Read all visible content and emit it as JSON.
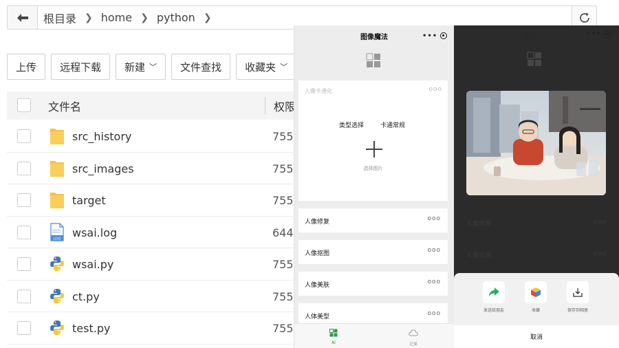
{
  "path_bar": {
    "crumbs": [
      "根目录",
      "home",
      "python"
    ]
  },
  "toolbar": {
    "upload": "上传",
    "remote_download": "远程下载",
    "new": "新建",
    "file_search": "文件查找",
    "favorites": "收藏夹"
  },
  "table": {
    "header_name": "文件名",
    "header_perm": "权限",
    "rows": [
      {
        "name": "src_history",
        "perm": "755 ,",
        "icon": "folder-icon"
      },
      {
        "name": "src_images",
        "perm": "755 ,",
        "icon": "folder-icon"
      },
      {
        "name": "target",
        "perm": "755 ,",
        "icon": "folder-icon"
      },
      {
        "name": "wsai.log",
        "perm": "644 ,",
        "icon": "log-file-icon"
      },
      {
        "name": "wsai.py",
        "perm": "755 ,",
        "icon": "python-file-icon"
      },
      {
        "name": "ct.py",
        "perm": "755 ,",
        "icon": "python-file-icon"
      },
      {
        "name": "test.py",
        "perm": "755 ,",
        "icon": "python-file-icon"
      }
    ]
  },
  "phone1": {
    "title": "图像魔法",
    "capsule_dots": "•••",
    "main_card": {
      "title": "人像卡通化",
      "more": "ooo",
      "type_label": "类型选择",
      "type_value": "卡通常规",
      "select_image": "选择图片"
    },
    "menu": [
      {
        "label": "人像修复",
        "more": "ooo"
      },
      {
        "label": "人像抠图",
        "more": "ooo"
      },
      {
        "label": "人像美肤",
        "more": "ooo"
      },
      {
        "label": "人体美型",
        "more": "ooo"
      }
    ],
    "tabs": [
      {
        "label": "AI"
      },
      {
        "label": "记录"
      }
    ]
  },
  "phone2": {
    "title": "图像魔法",
    "capsule_dots": "•••",
    "items": [
      {
        "label": "人像修复",
        "more": "ooo"
      },
      {
        "label": "人像抠图",
        "more": "ooo"
      }
    ],
    "share_sheet": {
      "options": [
        {
          "label": "发送给朋友",
          "icon": "share-arrow-icon"
        },
        {
          "label": "收藏",
          "icon": "favorite-cube-icon"
        },
        {
          "label": "保存到相册",
          "icon": "download-icon"
        }
      ],
      "cancel": "取消"
    }
  },
  "colors": {
    "folder": "#f5c342",
    "accent_green": "#2e9c43",
    "dark_overlay": "#2b2b2b"
  }
}
